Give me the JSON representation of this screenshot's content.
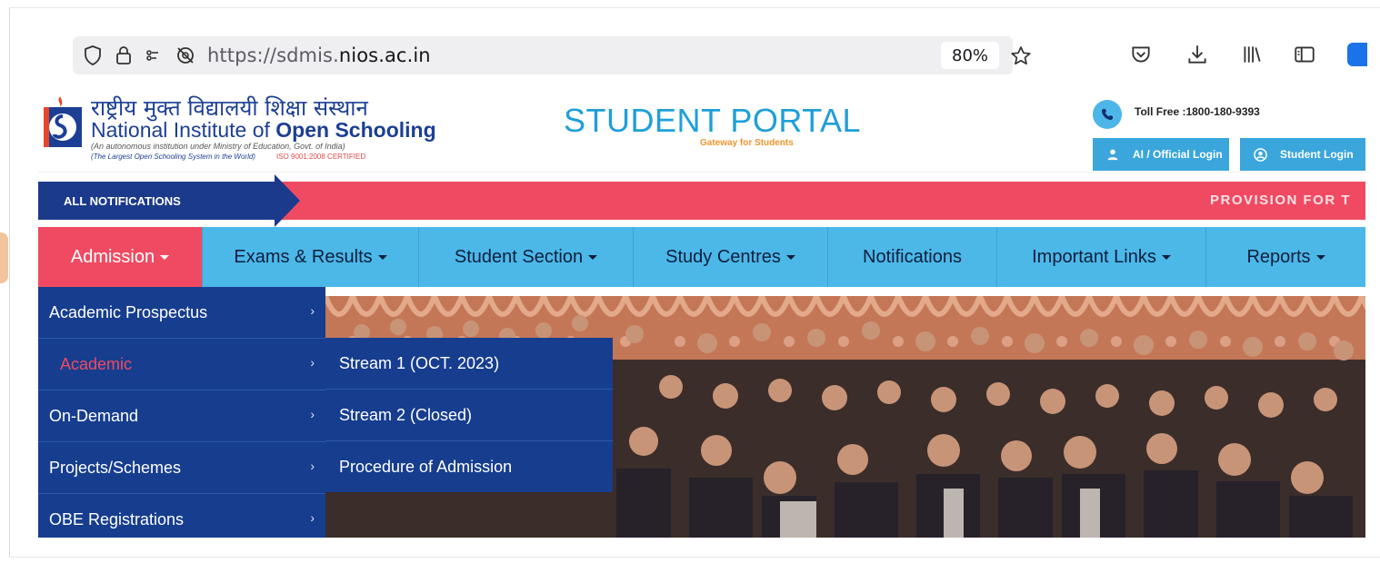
{
  "browser": {
    "url_prefix": "https://sdmis.",
    "url_domain": "nios.ac.in",
    "zoom": "80%"
  },
  "header": {
    "hindi_name": "राष्ट्रीय मुक्त विद्यालयी शिक्षा संस्थान",
    "name_regular": "National Institute of ",
    "name_bold": "Open Schooling",
    "subtitle": "(An autonomous institution under Ministry of Education, Govt. of India)",
    "tagline": "(The Largest Open Schooling System in the World)",
    "iso": "ISO 9001:2008 CERTIFIED",
    "portal_title": "STUDENT PORTAL",
    "portal_subtitle": "Gateway for Students",
    "toll_free": "Toll Free :1800-180-9393",
    "official_login": "AI / Official Login",
    "student_login": "Student Login"
  },
  "notifications": {
    "tag": "ALL NOTIFICATIONS",
    "ticker": "PROVISION FOR T"
  },
  "nav": [
    {
      "label": "Admission",
      "caret": true
    },
    {
      "label": "Exams & Results",
      "caret": true
    },
    {
      "label": "Student Section",
      "caret": true
    },
    {
      "label": "Study Centres",
      "caret": true
    },
    {
      "label": "Notifications",
      "caret": false
    },
    {
      "label": "Important Links",
      "caret": true
    },
    {
      "label": "Reports",
      "caret": true
    }
  ],
  "admission_menu": [
    {
      "label": "Academic Prospectus"
    },
    {
      "label": "Academic"
    },
    {
      "label": "On-Demand"
    },
    {
      "label": "Projects/Schemes"
    },
    {
      "label": "OBE Registrations"
    }
  ],
  "academic_submenu": [
    {
      "label": "Stream 1 (OCT. 2023)"
    },
    {
      "label": "Stream 2 (Closed)"
    },
    {
      "label": "Procedure of Admission"
    }
  ],
  "colors": {
    "nav_bg": "#4bb8e8",
    "active_red": "#f04a62",
    "navy": "#163d8e",
    "portal_blue": "#1f9fd8"
  }
}
